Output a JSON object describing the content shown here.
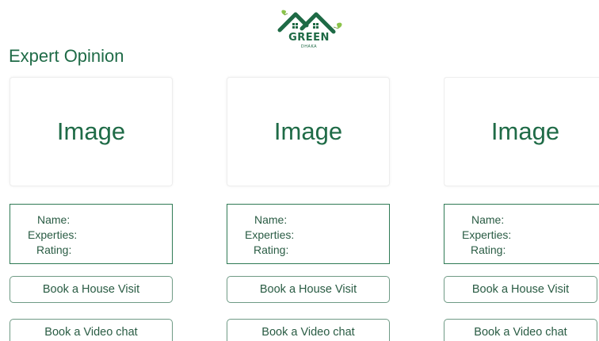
{
  "brand": {
    "word": "GREEN",
    "sub": "DHAKA",
    "color": "#1e6a45",
    "leaf_color": "#8bc34a"
  },
  "section": {
    "title": "Expert Opinion"
  },
  "experts": [
    {
      "image_label": "Image",
      "name_label": "Name:",
      "expertise_label": "Experties:",
      "rating_label": "Rating:",
      "visit_button": "Book a House Visit",
      "video_button": "Book a Video chat"
    },
    {
      "image_label": "Image",
      "name_label": "Name:",
      "expertise_label": "Experties:",
      "rating_label": "Rating:",
      "visit_button": "Book a House Visit",
      "video_button": "Book a Video chat"
    },
    {
      "image_label": "Image",
      "name_label": "Name:",
      "expertise_label": "Experties:",
      "rating_label": "Rating:",
      "visit_button": "Book a House Visit",
      "video_button": "Book a Video chat"
    }
  ]
}
